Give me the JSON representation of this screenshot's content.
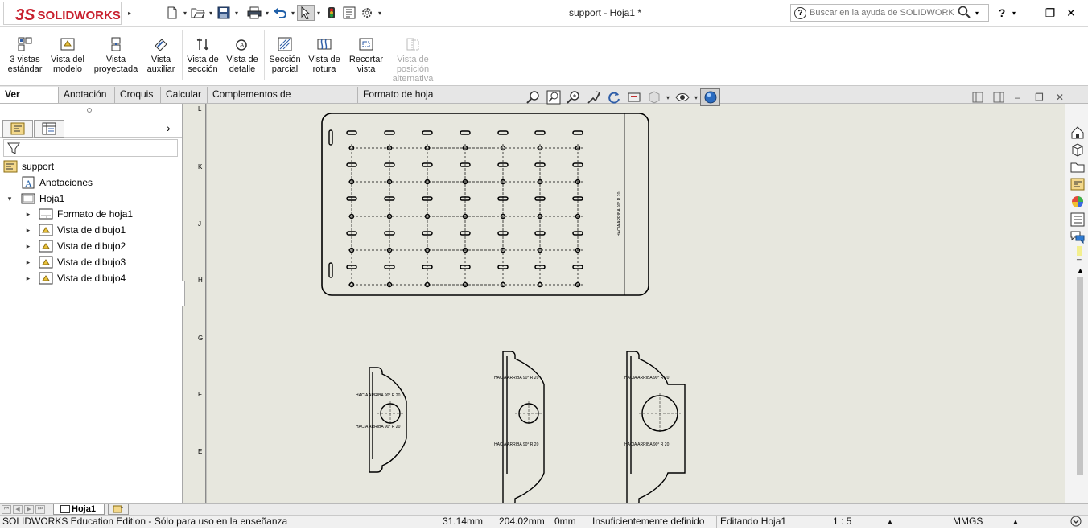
{
  "app": {
    "logo_ds": "3S",
    "logo_name": "SOLIDWORKS",
    "window_title": "support - Hoja1 *",
    "search_placeholder": "Buscar en la ayuda de SOLIDWORKS",
    "help_label": "?"
  },
  "ribbon": {
    "buttons": [
      {
        "id": "3-vistas",
        "label1": "3 vistas",
        "label2": "estándar",
        "enabled": true
      },
      {
        "id": "vista-modelo",
        "label1": "Vista del",
        "label2": "modelo",
        "enabled": true
      },
      {
        "id": "vista-proyectada",
        "label1": "Vista",
        "label2": "proyectada",
        "enabled": true
      },
      {
        "id": "vista-auxiliar",
        "label1": "Vista",
        "label2": "auxiliar",
        "enabled": true
      },
      {
        "id": "vista-seccion",
        "label1": "Vista de",
        "label2": "sección",
        "enabled": true
      },
      {
        "id": "vista-detalle",
        "label1": "Vista de",
        "label2": "detalle",
        "enabled": true
      },
      {
        "id": "seccion-parcial",
        "label1": "Sección",
        "label2": "parcial",
        "enabled": true
      },
      {
        "id": "vista-rotura",
        "label1": "Vista de",
        "label2": "rotura",
        "enabled": true
      },
      {
        "id": "recortar-vista",
        "label1": "Recortar",
        "label2": "vista",
        "enabled": true
      },
      {
        "id": "vista-posicion",
        "label1": "Vista de",
        "label2": "posición",
        "label3": "alternativa",
        "enabled": false
      }
    ]
  },
  "tabs": [
    {
      "label": "Ver diseño",
      "active": true
    },
    {
      "label": "Anotación",
      "active": false
    },
    {
      "label": "Croquis",
      "active": false
    },
    {
      "label": "Calcular",
      "active": false
    },
    {
      "label": "Complementos de SOLIDWORKS",
      "active": false
    },
    {
      "label": "Formato de hoja",
      "active": false
    }
  ],
  "tree": {
    "root": "support",
    "items": [
      {
        "label": "Anotaciones",
        "level": 1,
        "expander": ""
      },
      {
        "label": "Hoja1",
        "level": 1,
        "expander": "▾"
      },
      {
        "label": "Formato de hoja1",
        "level": 2,
        "expander": "▸"
      },
      {
        "label": "Vista de dibujo1",
        "level": 2,
        "expander": "▸"
      },
      {
        "label": "Vista de dibujo2",
        "level": 2,
        "expander": "▸"
      },
      {
        "label": "Vista de dibujo3",
        "level": 2,
        "expander": "▸"
      },
      {
        "label": "Vista de dibujo4",
        "level": 2,
        "expander": "▸"
      }
    ]
  },
  "ruler_letters": [
    "L",
    "K",
    "J",
    "H",
    "G",
    "F",
    "E"
  ],
  "drawing": {
    "plate_note": "HACIA ARRIBA 90° R 20",
    "view_note": "HACIA ARRIBA 90° R 20"
  },
  "sheet": {
    "tab_label": "Hoja1"
  },
  "status": {
    "edition": "SOLIDWORKS Education Edition - Sólo para uso en la enseñanza",
    "x": "31.14mm",
    "y": "204.02mm",
    "z": "0mm",
    "definition": "Insuficientemente definido",
    "editing": "Editando Hoja1",
    "scale": "1 : 5",
    "units": "MMGS"
  }
}
